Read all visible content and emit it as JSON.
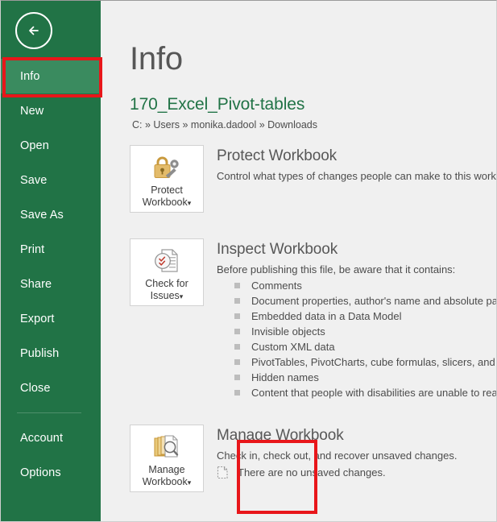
{
  "sidebar": {
    "back_icon": "back-arrow-icon",
    "items": [
      {
        "label": "Info",
        "active": true
      },
      {
        "label": "New",
        "active": false
      },
      {
        "label": "Open",
        "active": false
      },
      {
        "label": "Save",
        "active": false
      },
      {
        "label": "Save As",
        "active": false
      },
      {
        "label": "Print",
        "active": false
      },
      {
        "label": "Share",
        "active": false
      },
      {
        "label": "Export",
        "active": false
      },
      {
        "label": "Publish",
        "active": false
      },
      {
        "label": "Close",
        "active": false
      }
    ],
    "footer_items": [
      {
        "label": "Account"
      },
      {
        "label": "Options"
      }
    ],
    "bg_color": "#217346",
    "active_color": "#3a8b5f"
  },
  "highlight": {
    "color": "#e8161a",
    "targets": [
      "Info",
      "Manage Workbook"
    ]
  },
  "main": {
    "page_title": "Info",
    "file_name": "170_Excel_Pivot-tables",
    "file_path": "C: » Users » monika.dadool » Downloads",
    "file_name_color": "#217346"
  },
  "protect": {
    "button_label_line1": "Protect",
    "button_label_line2": "Workbook",
    "caret": "▾",
    "icon": "padlock-key-icon",
    "heading": "Protect Workbook",
    "description": "Control what types of changes people can make to this workbook."
  },
  "inspect": {
    "button_label_line1": "Check for",
    "button_label_line2": "Issues",
    "caret": "▾",
    "icon": "document-check-icon",
    "heading": "Inspect Workbook",
    "description": "Before publishing this file, be aware that it contains:",
    "bullets": [
      "Comments",
      "Document properties, author's name and absolute path",
      "Embedded data in a Data Model",
      "Invisible objects",
      "Custom XML data",
      "PivotTables, PivotCharts, cube formulas, slicers, and timelines",
      "Hidden names",
      "Content that people with disabilities are unable to read"
    ]
  },
  "manage": {
    "button_label_line1": "Manage",
    "button_label_line2": "Workbook",
    "caret": "▾",
    "icon": "documents-magnifier-icon",
    "heading": "Manage Workbook",
    "description": "Check in, check out, and recover unsaved changes.",
    "status_icon": "dashed-document-icon",
    "status_text": "There are no unsaved changes."
  }
}
